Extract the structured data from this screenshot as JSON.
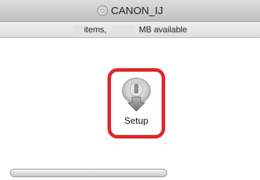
{
  "window": {
    "title": "CANON_IJ",
    "title_icon": "disc-volume-icon"
  },
  "status": {
    "items_label": "items,",
    "available_label": "MB available"
  },
  "files": [
    {
      "label": "Setup",
      "icon": "setup-installer-icon",
      "highlight_color": "#e0262b"
    }
  ],
  "colors": {
    "highlight": "#e0262b"
  }
}
